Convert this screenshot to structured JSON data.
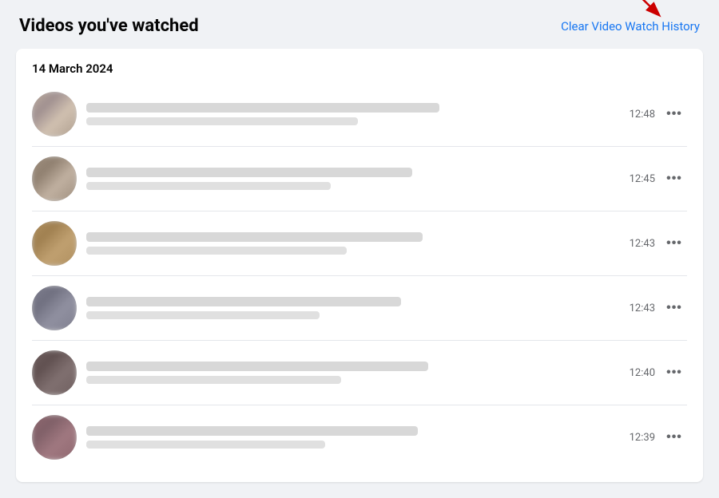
{
  "page": {
    "title": "Videos you've watched",
    "clear_history_label": "Clear Video Watch History"
  },
  "date_group": {
    "label": "14 March 2024"
  },
  "videos": [
    {
      "id": 1,
      "time": "12:48",
      "thumbnail_class": "thumbnail-blur",
      "title_width": "65%",
      "sub_width": "50%"
    },
    {
      "id": 2,
      "time": "12:45",
      "thumbnail_class": "thumbnail-blur-2",
      "title_width": "60%",
      "sub_width": "45%"
    },
    {
      "id": 3,
      "time": "12:43",
      "thumbnail_class": "thumbnail-blur-3",
      "title_width": "62%",
      "sub_width": "48%"
    },
    {
      "id": 4,
      "time": "12:43",
      "thumbnail_class": "thumbnail-blur-4",
      "title_width": "58%",
      "sub_width": "43%"
    },
    {
      "id": 5,
      "time": "12:40",
      "thumbnail_class": "thumbnail-blur-5",
      "title_width": "63%",
      "sub_width": "47%"
    },
    {
      "id": 6,
      "time": "12:39",
      "thumbnail_class": "thumbnail-blur-6",
      "title_width": "61%",
      "sub_width": "44%"
    }
  ],
  "more_options_label": "•••",
  "colors": {
    "link": "#1877f2",
    "arrow": "#cc0000"
  }
}
